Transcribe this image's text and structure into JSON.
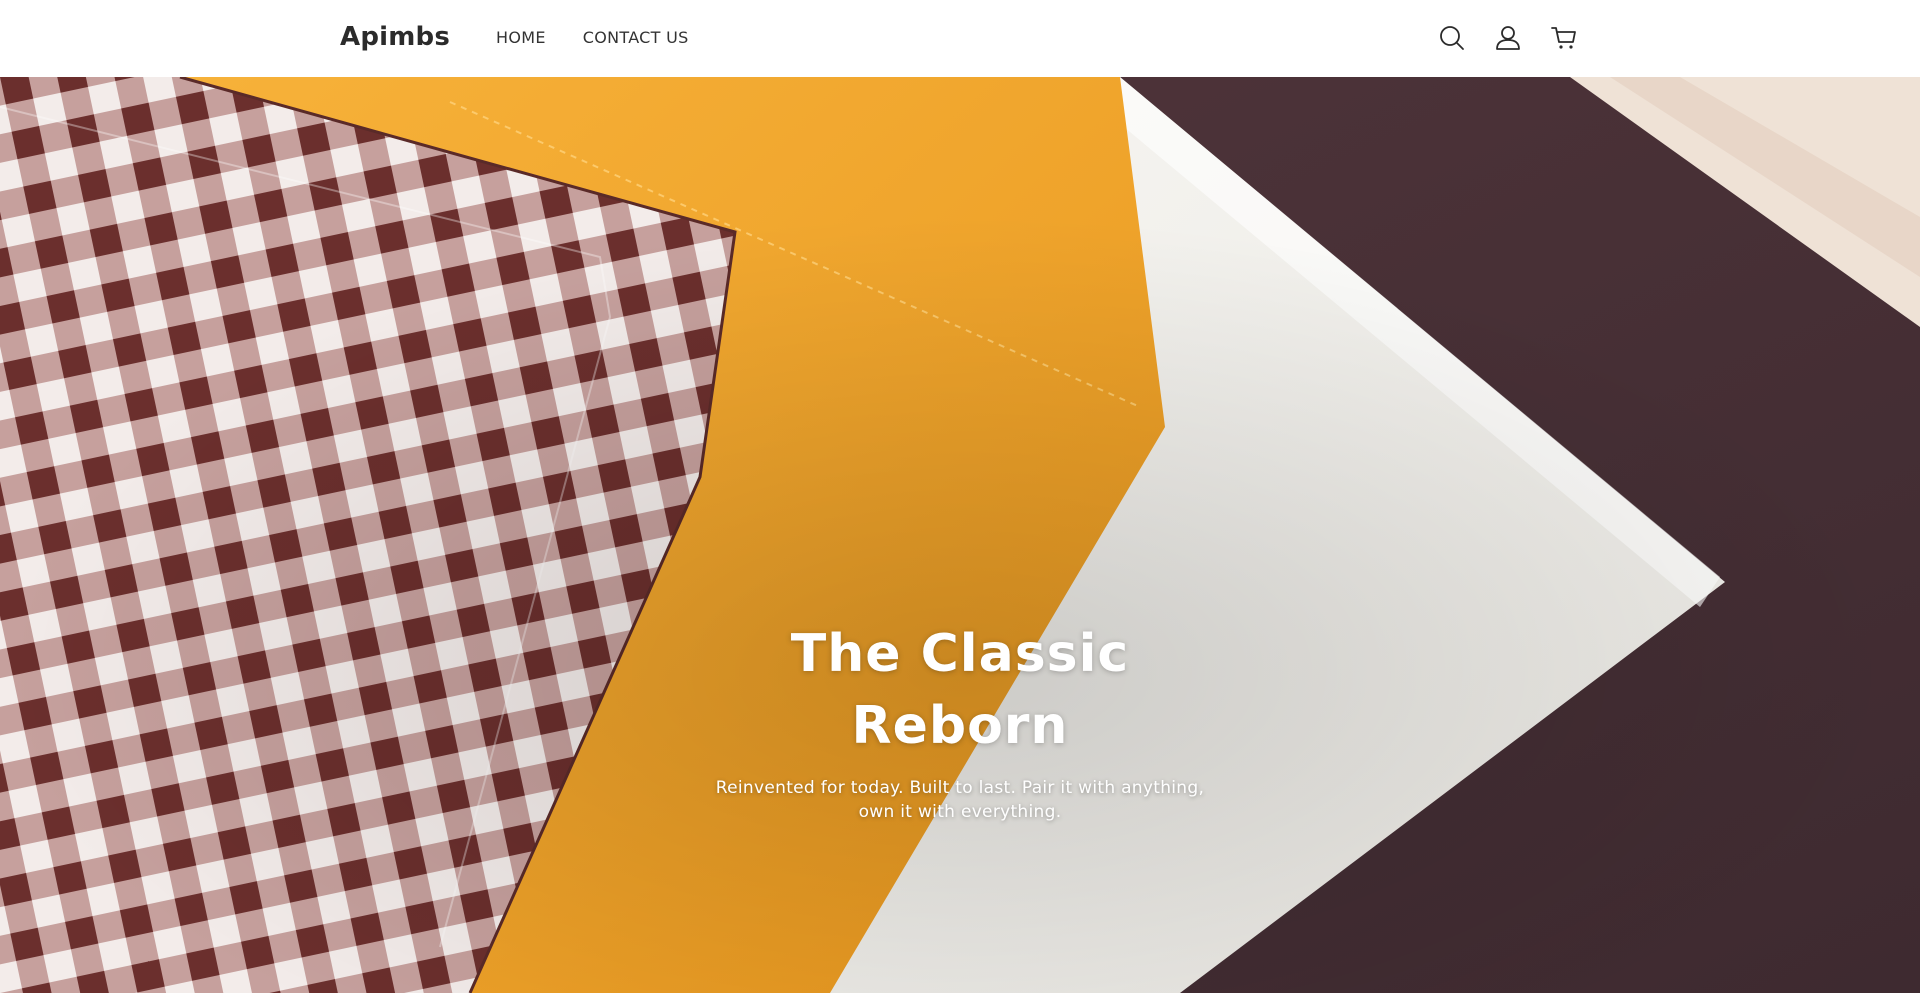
{
  "header": {
    "logo": "Apimbs",
    "nav": [
      {
        "label": "HOME"
      },
      {
        "label": "CONTACT US"
      }
    ],
    "icons": [
      "search-icon",
      "account-icon",
      "cart-icon"
    ]
  },
  "hero": {
    "title_line1": "The Classic",
    "title_line2": "Reborn",
    "subtitle_line1": "Reinvented for today. Built to last. Pair it with anything,",
    "subtitle_line2": "own it with everything."
  },
  "colors": {
    "header_bg": "#ffffff",
    "logo_text": "#2b2b2b",
    "hero_text": "#ffffff",
    "gingham_dark": "#6b2f2d",
    "mustard": "#f0a32a",
    "linen_white": "#f4f2ee",
    "plum_brown": "#4a3036"
  }
}
